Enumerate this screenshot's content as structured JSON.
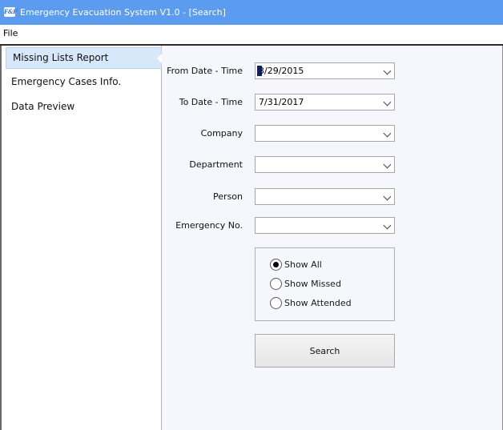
{
  "window": {
    "title": "Emergency Evacuation System V1.0 - [Search]",
    "icon": "app-logo-icon"
  },
  "menu": {
    "file": "File"
  },
  "sidebar": {
    "items": [
      {
        "label": "Missing Lists Report",
        "active": true
      },
      {
        "label": "Emergency Cases Info.",
        "active": false
      },
      {
        "label": "Data Preview",
        "active": false
      }
    ]
  },
  "form": {
    "from_date": {
      "label": "From Date - Time",
      "value": "3/29/2015"
    },
    "to_date": {
      "label": "To Date - Time",
      "value": "7/31/2017"
    },
    "company": {
      "label": "Company",
      "value": ""
    },
    "department": {
      "label": "Department",
      "value": ""
    },
    "person": {
      "label": "Person",
      "value": ""
    },
    "emergency_no": {
      "label": "Emergency No.",
      "value": ""
    },
    "filters": [
      {
        "label": "Show All",
        "checked": true
      },
      {
        "label": "Show Missed",
        "checked": false
      },
      {
        "label": "Show Attended",
        "checked": false
      }
    ],
    "search_label": "Search"
  },
  "colors": {
    "titlebar": "#5b9cf0",
    "sidebar_active": "#d7e8fb",
    "main_background": "#f6f7fc"
  }
}
